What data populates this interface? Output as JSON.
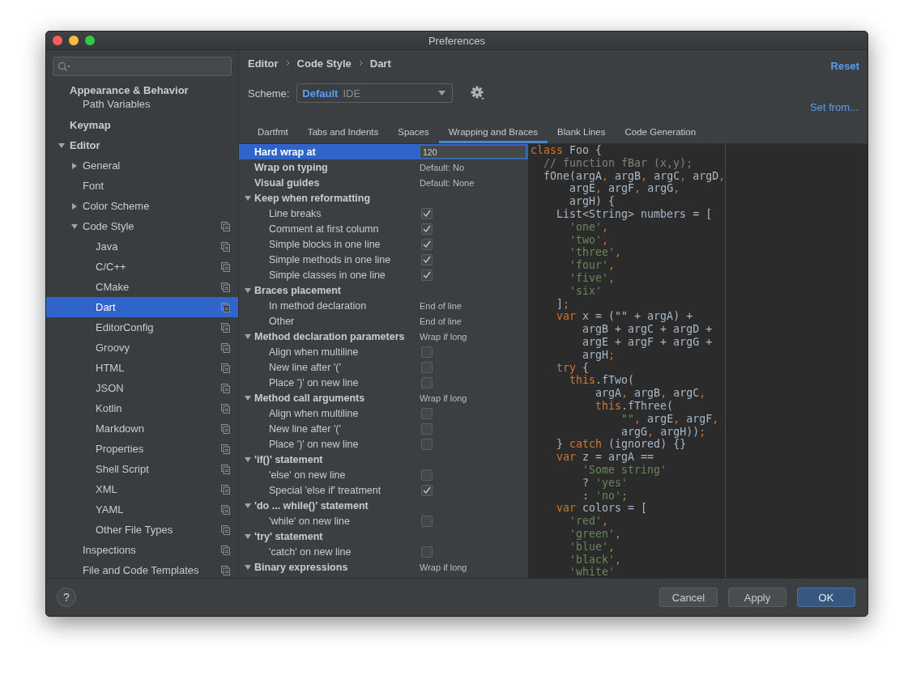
{
  "window": {
    "title": "Preferences"
  },
  "sidebar": {
    "items": [
      {
        "label": "Appearance & Behavior",
        "kind": "section",
        "selected": false,
        "copy_icon": false,
        "children": [
          {
            "label": "Path Variables",
            "kind": "leaf",
            "selected": false,
            "copy_icon": false
          }
        ]
      },
      {
        "label": "Keymap",
        "kind": "leaf",
        "selected": false,
        "copy_icon": false
      },
      {
        "label": "Editor",
        "kind": "group",
        "expanded": true,
        "selected": false,
        "copy_icon": false,
        "children": [
          {
            "label": "General",
            "kind": "group",
            "expanded": false,
            "selected": false,
            "copy_icon": false
          },
          {
            "label": "Font",
            "kind": "leaf",
            "selected": false,
            "copy_icon": false
          },
          {
            "label": "Color Scheme",
            "kind": "group",
            "expanded": false,
            "selected": false,
            "copy_icon": false
          },
          {
            "label": "Code Style",
            "kind": "group",
            "expanded": true,
            "selected": false,
            "copy_icon": true,
            "children": [
              {
                "label": "Java",
                "kind": "leaf",
                "selected": false,
                "copy_icon": true
              },
              {
                "label": "C/C++",
                "kind": "leaf",
                "selected": false,
                "copy_icon": true
              },
              {
                "label": "CMake",
                "kind": "leaf",
                "selected": false,
                "copy_icon": true
              },
              {
                "label": "Dart",
                "kind": "leaf",
                "selected": true,
                "copy_icon": true
              },
              {
                "label": "EditorConfig",
                "kind": "leaf",
                "selected": false,
                "copy_icon": true
              },
              {
                "label": "Groovy",
                "kind": "leaf",
                "selected": false,
                "copy_icon": true
              },
              {
                "label": "HTML",
                "kind": "leaf",
                "selected": false,
                "copy_icon": true
              },
              {
                "label": "JSON",
                "kind": "leaf",
                "selected": false,
                "copy_icon": true
              },
              {
                "label": "Kotlin",
                "kind": "leaf",
                "selected": false,
                "copy_icon": true
              },
              {
                "label": "Markdown",
                "kind": "leaf",
                "selected": false,
                "copy_icon": true
              },
              {
                "label": "Properties",
                "kind": "leaf",
                "selected": false,
                "copy_icon": true
              },
              {
                "label": "Shell Script",
                "kind": "leaf",
                "selected": false,
                "copy_icon": true
              },
              {
                "label": "XML",
                "kind": "leaf",
                "selected": false,
                "copy_icon": true
              },
              {
                "label": "YAML",
                "kind": "leaf",
                "selected": false,
                "copy_icon": true
              },
              {
                "label": "Other File Types",
                "kind": "leaf",
                "selected": false,
                "copy_icon": true
              }
            ]
          },
          {
            "label": "Inspections",
            "kind": "leaf",
            "selected": false,
            "copy_icon": true
          },
          {
            "label": "File and Code Templates",
            "kind": "leaf",
            "selected": false,
            "copy_icon": true
          }
        ]
      }
    ]
  },
  "breadcrumb": [
    "Editor",
    "Code Style",
    "Dart"
  ],
  "reset_link": "Reset",
  "scheme": {
    "label": "Scheme:",
    "name": "Default",
    "scope": "IDE"
  },
  "set_from_link": "Set from...",
  "tabs": [
    {
      "label": "Dartfmt",
      "selected": false
    },
    {
      "label": "Tabs and Indents",
      "selected": false
    },
    {
      "label": "Spaces",
      "selected": false
    },
    {
      "label": "Wrapping and Braces",
      "selected": true
    },
    {
      "label": "Blank Lines",
      "selected": false
    },
    {
      "label": "Code Generation",
      "selected": false
    }
  ],
  "settings": [
    {
      "kind": "field",
      "label": "Hard wrap at",
      "value": "120",
      "selected": true
    },
    {
      "kind": "value",
      "label": "Wrap on typing",
      "value": "Default: No",
      "selected": false
    },
    {
      "kind": "value",
      "label": "Visual guides",
      "value": "Default: None",
      "selected": false
    },
    {
      "kind": "group",
      "label": "Keep when reformatting",
      "expanded": true,
      "selected": false,
      "children": [
        {
          "kind": "check",
          "label": "Line breaks",
          "checked": true,
          "selected": false
        },
        {
          "kind": "check",
          "label": "Comment at first column",
          "checked": true,
          "selected": false
        },
        {
          "kind": "check",
          "label": "Simple blocks in one line",
          "checked": true,
          "selected": false
        },
        {
          "kind": "check",
          "label": "Simple methods in one line",
          "checked": true,
          "selected": false
        },
        {
          "kind": "check",
          "label": "Simple classes in one line",
          "checked": true,
          "selected": false
        }
      ]
    },
    {
      "kind": "group",
      "label": "Braces placement",
      "expanded": true,
      "selected": false,
      "children": [
        {
          "kind": "value",
          "label": "In method declaration",
          "value": "End of line",
          "selected": false
        },
        {
          "kind": "value",
          "label": "Other",
          "value": "End of line",
          "selected": false
        }
      ]
    },
    {
      "kind": "group",
      "label": "Method declaration parameters",
      "value": "Wrap if long",
      "expanded": true,
      "selected": false,
      "children": [
        {
          "kind": "check",
          "label": "Align when multiline",
          "checked": false,
          "selected": false
        },
        {
          "kind": "check",
          "label": "New line after '('",
          "checked": false,
          "selected": false
        },
        {
          "kind": "check",
          "label": "Place ')' on new line",
          "checked": false,
          "selected": false
        }
      ]
    },
    {
      "kind": "group",
      "label": "Method call arguments",
      "value": "Wrap if long",
      "expanded": true,
      "selected": false,
      "children": [
        {
          "kind": "check",
          "label": "Align when multiline",
          "checked": false,
          "selected": false
        },
        {
          "kind": "check",
          "label": "New line after '('",
          "checked": false,
          "selected": false
        },
        {
          "kind": "check",
          "label": "Place ')' on new line",
          "checked": false,
          "selected": false
        }
      ]
    },
    {
      "kind": "group",
      "label": "'if()' statement",
      "expanded": true,
      "selected": false,
      "children": [
        {
          "kind": "check",
          "label": "'else' on new line",
          "checked": false,
          "selected": false
        },
        {
          "kind": "check",
          "label": "Special 'else if' treatment",
          "checked": true,
          "selected": false
        }
      ]
    },
    {
      "kind": "group",
      "label": "'do ... while()' statement",
      "expanded": true,
      "selected": false,
      "children": [
        {
          "kind": "check",
          "label": "'while' on new line",
          "checked": false,
          "selected": false
        }
      ]
    },
    {
      "kind": "group",
      "label": "'try' statement",
      "expanded": true,
      "selected": false,
      "children": [
        {
          "kind": "check",
          "label": "'catch' on new line",
          "checked": false,
          "selected": false
        }
      ]
    },
    {
      "kind": "group",
      "label": "Binary expressions",
      "value": "Wrap if long",
      "expanded": true,
      "selected": false
    }
  ],
  "code_preview": [
    [
      {
        "kind": "keyword",
        "text": "class"
      },
      " Foo {"
    ],
    [
      {
        "kind": "comment",
        "text": "  // function fBar (x,y);"
      }
    ],
    [
      "  fOne(argA",
      {
        "kind": "punct",
        "text": ","
      },
      " argB",
      {
        "kind": "punct",
        "text": ","
      },
      " argC",
      {
        "kind": "punct",
        "text": ","
      },
      " argD",
      {
        "kind": "punct",
        "text": ","
      }
    ],
    [
      "      argE",
      {
        "kind": "punct",
        "text": ","
      },
      " argF",
      {
        "kind": "punct",
        "text": ","
      },
      " argG",
      {
        "kind": "punct",
        "text": ","
      }
    ],
    [
      "      argH) {"
    ],
    [
      "    List<String> numbers = ["
    ],
    [
      {
        "kind": "string",
        "text": "      'one'"
      },
      {
        "kind": "punct",
        "text": ","
      }
    ],
    [
      {
        "kind": "string",
        "text": "      'two'"
      },
      {
        "kind": "punct",
        "text": ","
      }
    ],
    [
      {
        "kind": "string",
        "text": "      'three'"
      },
      {
        "kind": "punct",
        "text": ","
      }
    ],
    [
      {
        "kind": "string",
        "text": "      'four'"
      },
      {
        "kind": "punct",
        "text": ","
      }
    ],
    [
      {
        "kind": "string",
        "text": "      'five'"
      },
      {
        "kind": "punct",
        "text": ","
      }
    ],
    [
      {
        "kind": "string",
        "text": "      'six'"
      }
    ],
    [
      "    ]",
      {
        "kind": "punct",
        "text": ";"
      }
    ],
    [
      {
        "kind": "keyword",
        "text": "    var"
      },
      " x = (\"\" + argA) +"
    ],
    [
      "        argB + argC + argD +"
    ],
    [
      "        argE + argF + argG +"
    ],
    [
      "        argH",
      {
        "kind": "punct",
        "text": ";"
      }
    ],
    [
      {
        "kind": "keyword",
        "text": "    try"
      },
      " {"
    ],
    [
      {
        "kind": "keyword",
        "text": "      this"
      },
      ".fTwo("
    ],
    [
      "          argA",
      {
        "kind": "punct",
        "text": ","
      },
      " argB",
      {
        "kind": "punct",
        "text": ","
      },
      " argC",
      {
        "kind": "punct",
        "text": ","
      }
    ],
    [
      {
        "kind": "keyword",
        "text": "          this"
      },
      ".fThree("
    ],
    [
      {
        "kind": "string",
        "text": "              \"\""
      },
      {
        "kind": "punct",
        "text": ","
      },
      " argE",
      {
        "kind": "punct",
        "text": ","
      },
      " argF",
      {
        "kind": "punct",
        "text": ","
      }
    ],
    [
      "              argG",
      {
        "kind": "punct",
        "text": ","
      },
      " argH))",
      {
        "kind": "punct",
        "text": ";"
      }
    ],
    [
      "    } ",
      {
        "kind": "keyword",
        "text": "catch"
      },
      " (ignored) {}"
    ],
    [
      {
        "kind": "keyword",
        "text": "    var"
      },
      " z = argA =="
    ],
    [
      {
        "kind": "string",
        "text": "        'Some string'"
      }
    ],
    [
      "        ? ",
      {
        "kind": "string",
        "text": "'yes'"
      }
    ],
    [
      "        : ",
      {
        "kind": "string",
        "text": "'no'"
      },
      {
        "kind": "punct",
        "text": ";"
      }
    ],
    [
      {
        "kind": "keyword",
        "text": "    var"
      },
      " colors = ["
    ],
    [
      {
        "kind": "string",
        "text": "      'red'"
      },
      {
        "kind": "punct",
        "text": ","
      }
    ],
    [
      {
        "kind": "string",
        "text": "      'green'"
      },
      {
        "kind": "punct",
        "text": ","
      }
    ],
    [
      {
        "kind": "string",
        "text": "      'blue'"
      },
      {
        "kind": "punct",
        "text": ","
      }
    ],
    [
      {
        "kind": "string",
        "text": "      'black'"
      },
      {
        "kind": "punct",
        "text": ","
      }
    ],
    [
      {
        "kind": "string",
        "text": "      'white'"
      }
    ]
  ],
  "footer": {
    "help": "?",
    "buttons": [
      {
        "label": "Cancel",
        "kind": "normal"
      },
      {
        "label": "Apply",
        "kind": "normal"
      },
      {
        "label": "OK",
        "kind": "default"
      }
    ]
  }
}
